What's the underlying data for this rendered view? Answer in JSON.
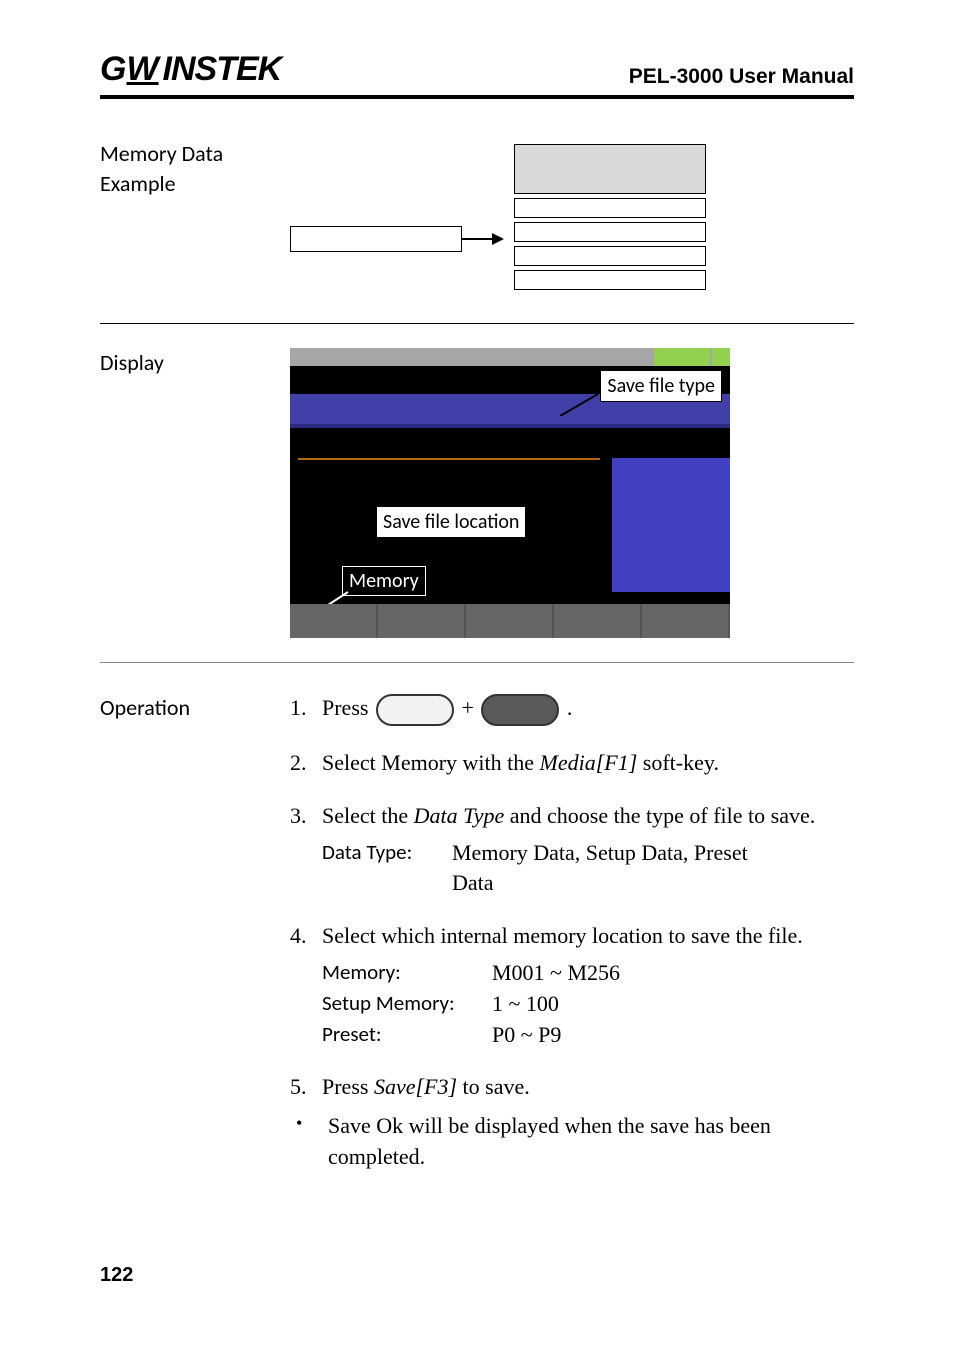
{
  "header": {
    "logo_text": "GWINSTEK",
    "manual": "PEL-3000 User Manual"
  },
  "sections": {
    "memory": {
      "label": "Memory Data\nExample"
    },
    "display": {
      "label": "Display",
      "callout_type": "Save file type",
      "callout_location": "Save file location",
      "callout_memory": "Memory"
    },
    "operation": {
      "label": "Operation",
      "step1_a": "Press ",
      "step1_plus": " + ",
      "step1_end": ".",
      "step2": "Select Memory with the ",
      "step2_i": "Media[F1]",
      "step2_b": " soft-key.",
      "step3_a": "Select the ",
      "step3_i": "Data Type",
      "step3_b": " and choose the type of file to save.",
      "step3_k": "Data Type:",
      "step3_v": "Memory Data, Setup Data, Preset Data",
      "step4_a": "Select which internal memory location to save the file.",
      "step4_k1": "Memory:",
      "step4_v1": "M001 ~ M256",
      "step4_k2": "Setup Memory:",
      "step4_v2": "1 ~ 100",
      "step4_k3": "Preset:",
      "step4_v3": "P0 ~ P9",
      "step5_a": "Press ",
      "step5_i": "Save[F3]",
      "step5_b": " to save.",
      "bullet": "Save Ok will be displayed when the save has been completed."
    }
  },
  "page_number": "122"
}
